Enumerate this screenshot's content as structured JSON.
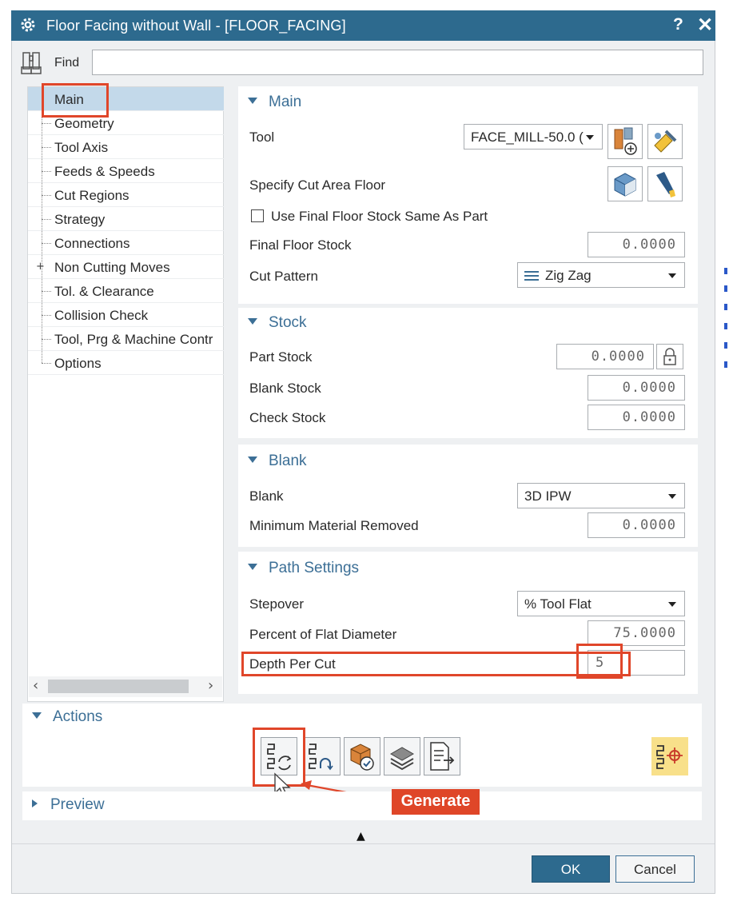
{
  "window": {
    "title": "Floor Facing without Wall - [FLOOR_FACING]",
    "help_label": "?",
    "close_label": "✕"
  },
  "find": {
    "label": "Find",
    "value": ""
  },
  "tree": {
    "items": [
      {
        "label": "Main",
        "selected": true
      },
      {
        "label": "Geometry"
      },
      {
        "label": "Tool Axis"
      },
      {
        "label": "Feeds & Speeds"
      },
      {
        "label": "Cut Regions"
      },
      {
        "label": "Strategy"
      },
      {
        "label": "Connections"
      },
      {
        "label": "Non Cutting Moves",
        "expandable": true
      },
      {
        "label": "Tol. & Clearance"
      },
      {
        "label": "Collision Check"
      },
      {
        "label": "Tool, Prg & Machine Contr"
      },
      {
        "label": "Options"
      }
    ],
    "scroll_left": "‹",
    "scroll_right": "›"
  },
  "main": {
    "title": "Main",
    "tool_label": "Tool",
    "tool_value": "FACE_MILL-50.0 (",
    "cut_area_label": "Specify Cut Area Floor",
    "use_final_floor_label": "Use Final Floor Stock Same As Part",
    "use_final_floor_checked": false,
    "final_floor_label": "Final Floor Stock",
    "final_floor_value": "0.0000",
    "cut_pattern_label": "Cut Pattern",
    "cut_pattern_value": "Zig Zag"
  },
  "stock": {
    "title": "Stock",
    "part_label": "Part Stock",
    "part_value": "0.0000",
    "blank_label": "Blank Stock",
    "blank_value": "0.0000",
    "check_label": "Check Stock",
    "check_value": "0.0000"
  },
  "blank": {
    "title": "Blank",
    "blank_label": "Blank",
    "blank_value": "3D IPW",
    "min_removed_label": "Minimum Material Removed",
    "min_removed_value": "0.0000"
  },
  "path": {
    "title": "Path Settings",
    "stepover_label": "Stepover",
    "stepover_value": "% Tool Flat",
    "percent_label": "Percent of Flat Diameter",
    "percent_value": "75.0000",
    "depth_label": "Depth Per Cut",
    "depth_value": "5"
  },
  "actions": {
    "title": "Actions"
  },
  "preview": {
    "title": "Preview"
  },
  "annotation": {
    "generate_label": "Generate"
  },
  "footer": {
    "ok_label": "OK",
    "cancel_label": "Cancel",
    "collapse_glyph": "▲"
  },
  "colors": {
    "titlebar": "#2d6a8e",
    "accent": "#3c6f96",
    "highlight": "#e0462a",
    "selection": "#c3d9ea"
  }
}
